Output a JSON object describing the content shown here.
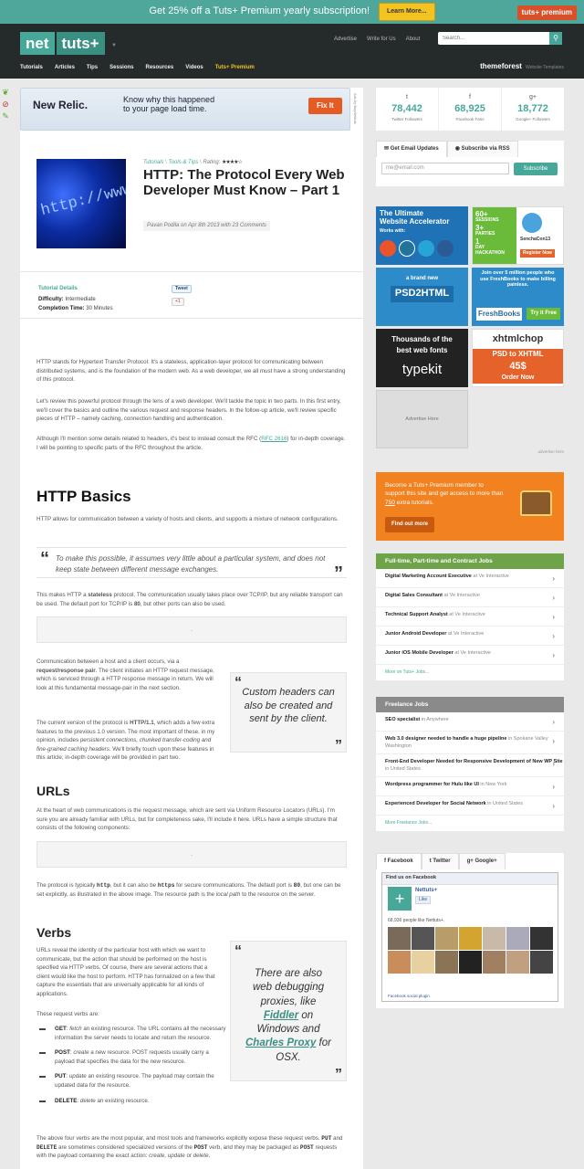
{
  "promo": {
    "text": "Get 25% off a Tuts+ Premium yearly subscription!",
    "button": "Learn More...",
    "brand": "tuts+ premium"
  },
  "header": {
    "logo_left": "net",
    "logo_right": "tuts+",
    "links": [
      "Advertise",
      "Write for Us",
      "About"
    ],
    "search_placeholder": "Search...",
    "nav": [
      "Tutorials",
      "Articles",
      "Tips",
      "Sessions",
      "Resources",
      "Videos"
    ],
    "nav_premium": "Tuts+ Premium",
    "themeforest": "themeforest",
    "themeforest_sub": "Website Templates"
  },
  "ad_banner": {
    "brand": "New Relic.",
    "text_line1": "Know why this happened",
    "text_line2": "to your page load time.",
    "button": "Fix It",
    "label": "Ads by BuySellAds"
  },
  "article": {
    "category": "Tutorials",
    "subcategory": "Tools & Tips",
    "rating_label": "Rating:",
    "stars": "★★★★☆",
    "thumb_text": "http://www",
    "title": "HTTP: The Protocol Every Web Developer Must Know – Part 1",
    "byline": "Pavan Podila on Apr 8th 2013 with 23 Comments",
    "details_title": "Tutorial Details",
    "difficulty_label": "Difficulty:",
    "difficulty": "Intermediate",
    "time_label": "Completion Time:",
    "time": "30 Minutes",
    "tweet": "Tweet",
    "plusone": "+1"
  },
  "body": {
    "p1": "HTTP stands for Hypertext Transfer Protocol. It's a stateless, application-layer protocol for communicating between distributed systems, and is the foundation of the modern web. As a web developer, we all must have a strong understanding of this protocol.",
    "p2": "Let's review this powerful protocol through the lens of a web developer. We'll tackle the topic in two parts. In this first entry, we'll cover the basics and outline the various request and response headers. In the follow-up article, we'll review specific pieces of HTTP – namely caching, connection handling and authentication.",
    "p3_a": "Although I'll mention some details related to headers, it's best to instead consult the RFC (",
    "p3_link": "RFC 2616",
    "p3_b": ") for in-depth coverage. I will be pointing to specific parts of the RFC throughout the article.",
    "h_basics": "HTTP Basics",
    "p4": "HTTP allows for communication between a variety of hosts and clients, and supports a mixture of network configurations.",
    "quote": "To make this possible, it assumes very little about a particular system, and does not keep state between different message exchanges.",
    "p5_a": "This makes HTTP a ",
    "p5_b": "stateless",
    "p5_c": " protocol. The communication usually takes place over TCP/IP, but any reliable transport can be used. The default port for TCP/IP is ",
    "p5_d": "80",
    "p5_e": ", but other ports can also be used.",
    "dot": ".",
    "p6_a": "Communication between a host and a client occurs, via a ",
    "p6_b": "request/response pair",
    "p6_c": ". The client initiates an HTTP request message, which is serviced through a HTTP response message in return. We will look at this fundamental message-pair in the next section.",
    "p7_a": "The current version of the protocol is ",
    "p7_b": "HTTP/1.1",
    "p7_c": ", which adds a few extra features to the previous 1.0 version. The most important of these, in my opinion, includes ",
    "p7_d": "persistent connections, chunked transfer-coding and fine-grained caching headers",
    "p7_e": ". We'll briefly touch upon these features in this article; in-depth coverage will be provided in part two.",
    "pullquote1": "Custom headers can also be created and sent by the client.",
    "h_urls": "URLs",
    "p8": "At the heart of web communications is the request message, which are sent via Uniform Resource Locators (URLs). I'm sure you are already familiar with URLs, but for completeness sake, I'll include it here. URLs have a simple structure that consists of the following components:",
    "p9_a": "The protocol is typically ",
    "p9_b": "http",
    "p9_c": ", but it can also be ",
    "p9_d": "https",
    "p9_e": " for secure communications. The default port is ",
    "p9_f": "80",
    "p9_g": ", but one can be set explicitly, as illustrated in the above image. The resource path is the ",
    "p9_h": "local path",
    "p9_i": " to the resource on the server.",
    "h_verbs": "Verbs",
    "p10": "URLs reveal the identity of the particular host with which we want to communicate, but the action that should be performed on the host is specified via HTTP verbs. Of course, there are several actions that a client would like the host to perform. HTTP has formalized on a few that capture the essentials that are universally applicable for all kinds of applications.",
    "p11": "These request verbs are:",
    "pullquote2_a": "There are also web debugging proxies, like ",
    "pullquote2_link1": "Fiddler",
    "pullquote2_b": " on Windows and ",
    "pullquote2_link2": "Charles Proxy",
    "pullquote2_c": " for OSX.",
    "verbs": [
      {
        "name": "GET",
        "action": "fetch",
        "rest": " an existing resource. The URL contains all the necessary information the server needs to locate and return the resource."
      },
      {
        "name": "POST",
        "action": "create",
        "rest": " a new resource. POST requests usually carry a payload that specifies the data for the new resource."
      },
      {
        "name": "PUT",
        "action": "update",
        "rest": " an existing resource. The payload may contain the updated data for the resource."
      },
      {
        "name": "DELETE",
        "action": "delete",
        "rest": " an existing resource."
      }
    ],
    "p12_a": "The above four verbs are the most popular, and most tools and frameworks explicitly expose these request verbs. ",
    "p12_put": "PUT",
    "p12_and": " and ",
    "p12_del": "DELETE",
    "p12_b": " are sometimes considered specialized versions of the ",
    "p12_post": "POST",
    "p12_c": " verb, and they may be packaged as ",
    "p12_post2": "POST",
    "p12_d": " requests with the payload containing the exact action: ",
    "p12_e": "create, update",
    "p12_f": " or ",
    "p12_g": "delete",
    "p12_h": "."
  },
  "sidebar": {
    "stats": [
      {
        "icon": "twitter-icon",
        "glyph": "t",
        "num": "78,442",
        "label": "Twitter Followers"
      },
      {
        "icon": "facebook-icon",
        "glyph": "f",
        "num": "68,925",
        "label": "Facebook Fans"
      },
      {
        "icon": "googleplus-icon",
        "glyph": "g+",
        "num": "18,772",
        "label": "Google+ Followers"
      }
    ],
    "email_tab": "Get Email Updates",
    "rss_tab": "Subscribe via RSS",
    "email_placeholder": "me@email.com",
    "subscribe": "Subscribe",
    "ads": {
      "a1_l1": "The Ultimate",
      "a1_l2": "Website Accelerator",
      "a1_l3": "Works with:",
      "a2_l1": "60+",
      "a2_l2": "SESSIONS",
      "a2_l3": "3+",
      "a2_l4": "PARTIES",
      "a2_l5": "1",
      "a2_l6": "DAY",
      "a2_l7": "HACKATHON",
      "a2_brand": "SenchaCon13",
      "a2_btn": "Register Now",
      "a3_l1": "a brand new",
      "a3_l2": "PSD2HTML",
      "a4_l1": "Join over 5 million people who use FreshBooks to make billing painless.",
      "a4_brand": "FreshBooks",
      "a4_btn": "Try it Free",
      "a5_l1": "Thousands of the",
      "a5_l2": "best web fonts",
      "a5_brand": "typekit",
      "a6_brand": "xhtmlchop",
      "a6_l1": "PSD to XHTML",
      "a6_price": "45",
      "a6_cents": "$",
      "a6_btn": "Order Now",
      "advertise": "Advertise Here"
    },
    "advertise_here": "advertise here",
    "premium_text_a": "Become a Tuts+ Premium member to support this site and get access to more than ",
    "premium_count": "750",
    "premium_text_b": " extra tutorials.",
    "premium_btn": "Find out more",
    "jobs_title": "Full-time, Part-time and Contract Jobs",
    "jobs": [
      {
        "title": "Digital Marketing Account Executive",
        "at": " at ",
        "company": "Ve Interactive"
      },
      {
        "title": "Digital Sales Consultant",
        "at": " at ",
        "company": "Ve Interactive"
      },
      {
        "title": "Technical Support Analyst",
        "at": " at ",
        "company": "Ve Interactive"
      },
      {
        "title": "Junior Android Developer",
        "at": " at ",
        "company": "Ve Interactive"
      },
      {
        "title": "Junior iOS Mobile Developer",
        "at": " at ",
        "company": "Ve Interactive"
      }
    ],
    "jobs_more": "More on Tuts+ Jobs...",
    "freelance_title": "Freelance Jobs",
    "freelance": [
      {
        "title": "SEO specialist",
        "at": " in ",
        "company": "Anywhere"
      },
      {
        "title": "Web 3.0 designer needed to handle a huge pipeline",
        "at": " in ",
        "company": "Spokane Valley Washington"
      },
      {
        "title": "Front-End Developer Needed for Responsive Development of New WP Site",
        "at": " in ",
        "company": "United States"
      },
      {
        "title": "Wordpress programmer for Hulu like UI",
        "at": " in ",
        "company": "New York"
      },
      {
        "title": "Experienced Developer for Social Network",
        "at": " in ",
        "company": "United States"
      }
    ],
    "freelance_more": "More Freelance Jobs...",
    "social_tabs": [
      "Facebook",
      "Twitter",
      "Google+"
    ],
    "fb_find": "Find us on Facebook",
    "fb_name": "Nettuts+",
    "fb_like": "Like",
    "fb_count": "68,936 people like Nettuts+.",
    "fb_plugin": "Facebook social plugin"
  },
  "colors": {
    "accent": "#47a89a",
    "promo_bg": "#4fa79b",
    "header_bg": "#252a2b",
    "premium": "#f2811f",
    "jobs_green": "#6ea34a",
    "freelance_gray": "#8a8a8a"
  }
}
